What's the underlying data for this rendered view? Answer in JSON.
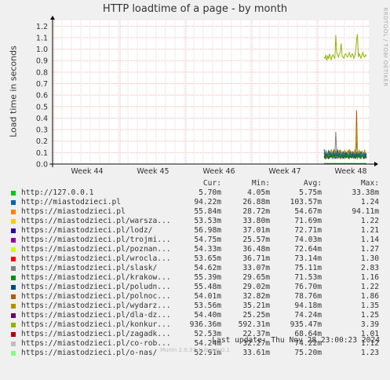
{
  "title": "HTTP loadtime of a page - by month",
  "watermark": "RRDTOOL / TOBI OETIKER",
  "footer": "Munin 2.0.37-1ubuntu0.1",
  "last_update": "Last update:  Thu Nov 28 23:00:23 2024",
  "legend_headers": {
    "cur": "Cur:",
    "min": "Min:",
    "avg": "Avg:",
    "max": "Max:"
  },
  "legend": [
    {
      "name": "http://127.0.0.1",
      "color": "#00cc00",
      "cur": "5.70m",
      "min": "4.05m",
      "avg": "5.75m",
      "max": "33.38m"
    },
    {
      "name": "http://miastodzieci.pl",
      "color": "#0066b3",
      "cur": "94.22m",
      "min": "26.88m",
      "avg": "103.57m",
      "max": "1.24"
    },
    {
      "name": "https://miastodzieci.pl",
      "color": "#ff8000",
      "cur": "55.84m",
      "min": "28.72m",
      "avg": "54.67m",
      "max": "94.11m"
    },
    {
      "name": "https://miastodzieci.pl/warsza...",
      "color": "#ffcc00",
      "cur": "53.53m",
      "min": "33.80m",
      "avg": "71.69m",
      "max": "1.22"
    },
    {
      "name": "https://miastodzieci.pl/lodz/",
      "color": "#330099",
      "cur": "56.98m",
      "min": "37.01m",
      "avg": "72.71m",
      "max": "1.21"
    },
    {
      "name": "https://miastodzieci.pl/trojmi...",
      "color": "#990099",
      "cur": "54.75m",
      "min": "25.57m",
      "avg": "74.03m",
      "max": "1.14"
    },
    {
      "name": "https://miastodzieci.pl/poznan...",
      "color": "#ccff00",
      "cur": "54.33m",
      "min": "36.48m",
      "avg": "72.64m",
      "max": "1.27"
    },
    {
      "name": "https://miastodzieci.pl/wrocla...",
      "color": "#ff0000",
      "cur": "53.65m",
      "min": "36.71m",
      "avg": "73.14m",
      "max": "1.30"
    },
    {
      "name": "https://miastodzieci.pl/slask/",
      "color": "#808080",
      "cur": "54.62m",
      "min": "33.07m",
      "avg": "75.11m",
      "max": "2.83"
    },
    {
      "name": "https://miastodzieci.pl/krakow...",
      "color": "#008f00",
      "cur": "55.39m",
      "min": "29.65m",
      "avg": "71.53m",
      "max": "1.16"
    },
    {
      "name": "https://miastodzieci.pl/poludn...",
      "color": "#00487d",
      "cur": "55.48m",
      "min": "29.02m",
      "avg": "76.70m",
      "max": "1.22"
    },
    {
      "name": "https://miastodzieci.pl/polnoc...",
      "color": "#b35a00",
      "cur": "54.01m",
      "min": "32.82m",
      "avg": "78.76m",
      "max": "1.86"
    },
    {
      "name": "https://miastodzieci.pl/wydarz...",
      "color": "#b38f00",
      "cur": "53.56m",
      "min": "35.21m",
      "avg": "94.18m",
      "max": "1.35"
    },
    {
      "name": "https://miastodzieci.pl/dla-dz...",
      "color": "#6b006b",
      "cur": "54.40m",
      "min": "25.25m",
      "avg": "74.24m",
      "max": "1.25"
    },
    {
      "name": "https://miastodzieci.pl/konkur...",
      "color": "#8fb300",
      "cur": "936.36m",
      "min": "592.31m",
      "avg": "935.47m",
      "max": "3.39"
    },
    {
      "name": "https://miastodzieci.pl/zagadk...",
      "color": "#b30000",
      "cur": "52.53m",
      "min": "22.37m",
      "avg": "68.64m",
      "max": "1.01"
    },
    {
      "name": "https://miastodzieci.pl/co-rob...",
      "color": "#bebebe",
      "cur": "54.24m",
      "min": "32.27m",
      "avg": "74.22m",
      "max": "1.12"
    },
    {
      "name": "https://miastodzieci.pl/o-nas/",
      "color": "#80ff80",
      "cur": "52.91m",
      "min": "33.61m",
      "avg": "75.20m",
      "max": "1.23"
    }
  ],
  "chart_data": {
    "type": "line",
    "ylabel": "Load time in seconds",
    "ylim": [
      0,
      1.25
    ],
    "yticks": [
      "0.0",
      "0.1",
      "0.2",
      "0.3",
      "0.4",
      "0.5",
      "0.6",
      "0.7",
      "0.8",
      "0.9",
      "1.0",
      "1.1",
      "1.2"
    ],
    "xticks": [
      "Week 44",
      "Week 45",
      "Week 46",
      "Week 47",
      "Week 48"
    ],
    "grid": true,
    "series": [
      {
        "name": "https://miastodzieci.pl/konkur...",
        "color": "#8fb300",
        "values": [
          0.93,
          0.92,
          0.95,
          0.9,
          0.94,
          0.92,
          0.96,
          0.93,
          0.91,
          0.94,
          0.95,
          0.93,
          0.92,
          1.12,
          0.97,
          0.95,
          0.93,
          0.96,
          0.98,
          1.05,
          0.94,
          0.93,
          0.92,
          0.95,
          0.96,
          0.94,
          0.93,
          0.95,
          0.97,
          0.94,
          0.93,
          0.96,
          0.95,
          0.92,
          0.94,
          0.98,
          1.08,
          1.13,
          0.93,
          0.96,
          0.94,
          0.92,
          0.95,
          0.97,
          0.94,
          0.93,
          0.95,
          0.94
        ]
      },
      {
        "name": "https://miastodzieci.pl/polnoc...",
        "color": "#b35a00",
        "values": [
          0.1,
          0.06,
          0.12,
          0.08,
          0.05,
          0.09,
          0.11,
          0.07,
          0.1,
          0.06,
          0.08,
          0.13,
          0.09,
          0.07,
          0.1,
          0.08,
          0.06,
          0.12,
          0.09,
          0.07,
          0.1,
          0.06,
          0.09,
          0.11,
          0.08,
          0.1,
          0.07,
          0.12,
          0.09,
          0.06,
          0.1,
          0.08,
          0.07,
          0.11,
          0.06,
          0.09,
          0.47,
          0.12,
          0.08,
          0.1,
          0.07,
          0.09,
          0.11,
          0.06,
          0.08,
          0.1,
          0.07,
          0.09
        ]
      },
      {
        "name": "https://miastodzieci.pl/slask/",
        "color": "#808080",
        "values": [
          0.09,
          0.07,
          0.1,
          0.06,
          0.08,
          0.11,
          0.07,
          0.09,
          0.06,
          0.1,
          0.08,
          0.07,
          0.09,
          0.28,
          0.1,
          0.07,
          0.08,
          0.06,
          0.09,
          0.11,
          0.07,
          0.08,
          0.1,
          0.06,
          0.09,
          0.07,
          0.08,
          0.1,
          0.06,
          0.09,
          0.07,
          0.11,
          0.08,
          0.06,
          0.1,
          0.07,
          0.2,
          0.09,
          0.07,
          0.08,
          0.1,
          0.06,
          0.09,
          0.07,
          0.08,
          0.1,
          0.07,
          0.06
        ]
      },
      {
        "name": "https://miastodzieci.pl/wydarz...",
        "color": "#b38f00",
        "values": [
          0.1,
          0.08,
          0.12,
          0.09,
          0.07,
          0.11,
          0.1,
          0.08,
          0.13,
          0.09,
          0.1,
          0.12,
          0.08,
          0.11,
          0.09,
          0.13,
          0.1,
          0.08,
          0.12,
          0.1,
          0.09,
          0.11,
          0.08,
          0.12,
          0.1,
          0.09,
          0.11,
          0.08,
          0.13,
          0.1,
          0.09,
          0.11,
          0.1,
          0.08,
          0.12,
          0.1,
          0.33,
          0.1,
          0.09,
          0.12,
          0.1,
          0.08,
          0.11,
          0.09,
          0.1,
          0.12,
          0.08,
          0.1
        ]
      },
      {
        "name": "https://miastodzieci.pl/dla-dz...",
        "color": "#6b006b",
        "values": [
          0.07,
          0.05,
          0.08,
          0.06,
          0.09,
          0.05,
          0.07,
          0.06,
          0.08,
          0.05,
          0.07,
          0.09,
          0.06,
          0.05,
          0.08,
          0.07,
          0.06,
          0.09,
          0.05,
          0.07,
          0.08,
          0.06,
          0.05,
          0.07,
          0.09,
          0.06,
          0.08,
          0.05,
          0.07,
          0.06,
          0.08,
          0.05,
          0.09,
          0.06,
          0.07,
          0.05,
          0.08,
          0.06,
          0.07,
          0.09,
          0.05,
          0.06,
          0.08,
          0.07,
          0.05,
          0.06,
          0.08,
          0.05
        ]
      },
      {
        "name": "http://miastodzieci.pl",
        "color": "#0066b3",
        "values": [
          0.13,
          0.08,
          0.1,
          0.06,
          0.09,
          0.12,
          0.07,
          0.1,
          0.08,
          0.06,
          0.11,
          0.09,
          0.07,
          0.1,
          0.08,
          0.12,
          0.06,
          0.09,
          0.1,
          0.07,
          0.08,
          0.11,
          0.06,
          0.09,
          0.07,
          0.1,
          0.08,
          0.06,
          0.09,
          0.11,
          0.07,
          0.08,
          0.1,
          0.06,
          0.09,
          0.07,
          0.1,
          0.08,
          0.06,
          0.09,
          0.07,
          0.11,
          0.08,
          0.06,
          0.1,
          0.07,
          0.09,
          0.08
        ]
      },
      {
        "name": "https://miastodzieci.pl/krakow...",
        "color": "#008f00",
        "values": [
          0.06,
          0.08,
          0.05,
          0.07,
          0.09,
          0.06,
          0.05,
          0.08,
          0.07,
          0.06,
          0.09,
          0.05,
          0.07,
          0.08,
          0.06,
          0.05,
          0.09,
          0.07,
          0.06,
          0.08,
          0.05,
          0.07,
          0.06,
          0.09,
          0.05,
          0.08,
          0.06,
          0.07,
          0.05,
          0.09,
          0.06,
          0.08,
          0.07,
          0.05,
          0.06,
          0.08,
          0.07,
          0.05,
          0.09,
          0.06,
          0.07,
          0.05,
          0.08,
          0.06,
          0.07,
          0.05,
          0.06,
          0.07
        ]
      },
      {
        "name": "http://127.0.0.1",
        "color": "#00cc00",
        "values": [
          0.006,
          0.006,
          0.005,
          0.006,
          0.006,
          0.005,
          0.006,
          0.006,
          0.005,
          0.006,
          0.006,
          0.005,
          0.006,
          0.006,
          0.005,
          0.006,
          0.006,
          0.005,
          0.006,
          0.006,
          0.005,
          0.006,
          0.006,
          0.005,
          0.006,
          0.006,
          0.005,
          0.006,
          0.006,
          0.005,
          0.006,
          0.006,
          0.005,
          0.006,
          0.006,
          0.005,
          0.006,
          0.006,
          0.005,
          0.006,
          0.006,
          0.005,
          0.006,
          0.006,
          0.005,
          0.006,
          0.006,
          0.006
        ]
      }
    ]
  }
}
